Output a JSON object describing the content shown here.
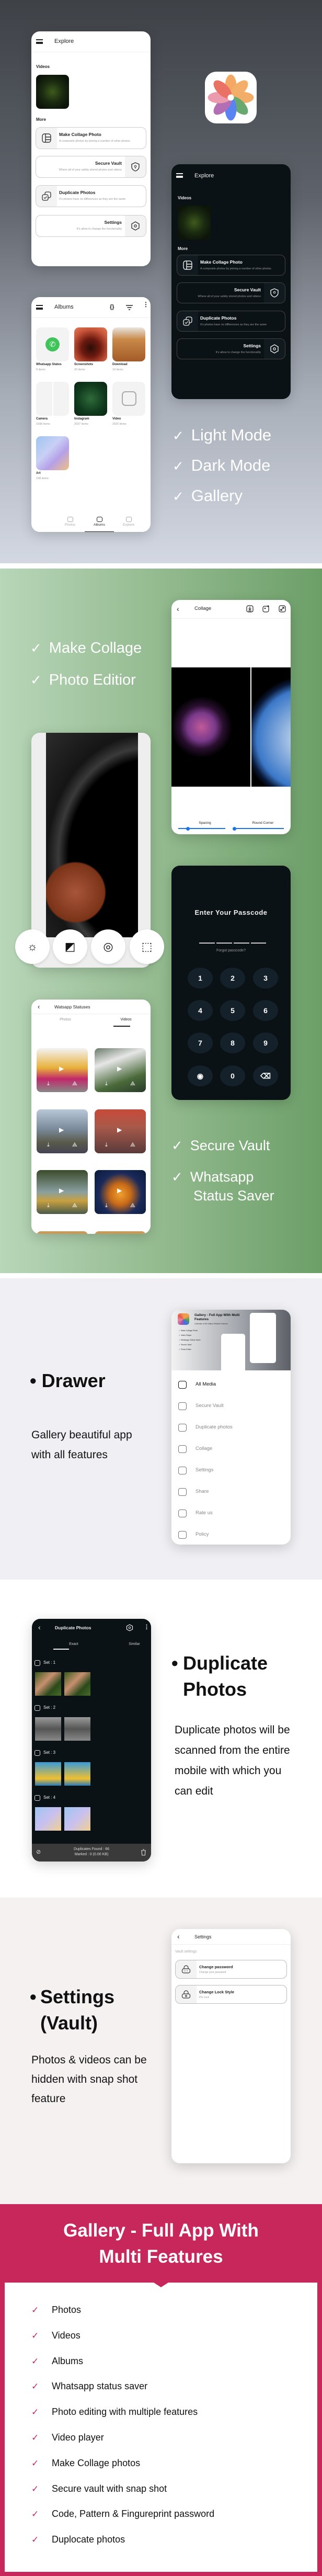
{
  "colors": {
    "accent_red": "#c8275b",
    "slider_blue": "#1a73e8",
    "dark_bg": "#0b1216"
  },
  "hero": {
    "features": [
      "Light Mode",
      "Dark Mode",
      "Gallery"
    ],
    "app_icon": "flower-photos-icon"
  },
  "explore": {
    "title": "Explore",
    "videos_label": "Videos",
    "more_label": "More",
    "cards": [
      {
        "title": "Make Collage Photo",
        "subtitle": "A composite photos by joining a number of other photos",
        "icon": "collage-icon"
      },
      {
        "title": "Secure Vault",
        "subtitle": "Where all of your safely stored photos and videos",
        "icon": "shield-icon"
      },
      {
        "title": "Duplicate Photos",
        "subtitle": "It's photos have no differences as they are the same",
        "icon": "duplicate-icon"
      },
      {
        "title": "Settings",
        "subtitle": "It's allow to change the functionality",
        "icon": "settings-icon"
      }
    ]
  },
  "albums": {
    "title": "Albums",
    "items": [
      {
        "name": "Whatsapp Status",
        "count": "0 items"
      },
      {
        "name": "Screenshots",
        "count": "20 items"
      },
      {
        "name": "Download",
        "count": "10 items"
      },
      {
        "name": "Camera",
        "count": "1598 items"
      },
      {
        "name": "Instagram",
        "count": "2027 items"
      },
      {
        "name": "Video",
        "count": "2020 items"
      },
      {
        "name": "Art",
        "count": "198 items"
      }
    ],
    "nav": [
      "Photos",
      "Albums",
      "Explore"
    ],
    "active_nav": "Albums"
  },
  "collage_features": [
    "Make Collage",
    "Photo Editior"
  ],
  "collage": {
    "title": "Collage",
    "sliders": [
      {
        "label": "Spacing",
        "value": 0.2
      },
      {
        "label": "Round Corner",
        "value": 0
      }
    ]
  },
  "editor": {
    "tools": [
      "brightness-icon",
      "exposure-icon",
      "saturation-icon",
      "vignette-icon"
    ]
  },
  "passcode": {
    "title": "Enter Your Passcode",
    "forgot": "Forgot passcode?",
    "keys": [
      "1",
      "2",
      "3",
      "4",
      "5",
      "6",
      "7",
      "8",
      "9",
      "fingerprint",
      "0",
      "backspace"
    ]
  },
  "statuses": {
    "title": "Watsapp Statuses",
    "tabs": [
      "Photos",
      "Videos"
    ],
    "active_tab": "Videos"
  },
  "vault_features": [
    "Secure Vault",
    "Whatsapp Status Saver"
  ],
  "drawer": {
    "heading": "Drawer",
    "description": "Gallery beautiful app with all features",
    "banner": {
      "title": "Gallery - Full App With Multi Features",
      "subtitle": "Collection of All Gallery Related Features",
      "features": [
        "Make Collage Photo",
        "Video Player",
        "Whatsapp Status Saver",
        "Secure Vault",
        "Photo Editor"
      ]
    },
    "menu": [
      {
        "label": "All Media",
        "icon": "image-icon",
        "active": true
      },
      {
        "label": "Secure Vault",
        "icon": "shield-icon"
      },
      {
        "label": "Duplicate photos",
        "icon": "duplicate-icon"
      },
      {
        "label": "Collage",
        "icon": "collage-icon"
      },
      {
        "label": "Settings",
        "icon": "settings-icon"
      },
      {
        "label": "Share",
        "icon": "share-icon"
      },
      {
        "label": "Rate us",
        "icon": "star-icon"
      },
      {
        "label": "Policy",
        "icon": "policy-icon"
      }
    ]
  },
  "duplicate": {
    "heading": "Duplicate Photos",
    "description": "Duplicate photos will be scanned from the entire mobile with which you can edit",
    "screen": {
      "title": "Duplicate Photos",
      "tabs": [
        "Exact",
        "Similar"
      ],
      "active_tab": "Exact",
      "sets": [
        "Set : 1",
        "Set : 2",
        "Set : 3",
        "Set : 4"
      ],
      "found": "Duplicates Found : 66",
      "marked": "Marked : 0 (0.00 KB)"
    }
  },
  "settings": {
    "heading": "Settings (Vault)",
    "description": "Photos & videos can be hidden with snap shot feature",
    "screen": {
      "title": "Settings",
      "section": "Vault settings",
      "items": [
        {
          "title": "Change password",
          "subtitle": "Change your password"
        },
        {
          "title": "Change Lock Style",
          "subtitle": "Pin Lock"
        }
      ]
    }
  },
  "summary": {
    "title": "Gallery - Full App With Multi Features",
    "features": [
      "Photos",
      "Videos",
      "Albums",
      "Whatsapp status saver",
      "Photo editing with multiple features",
      "Video player",
      "Make Collage photos",
      "Secure vault with snap shot",
      "Code, Pattern & Fingureprint password",
      "Duplocate photos"
    ]
  }
}
